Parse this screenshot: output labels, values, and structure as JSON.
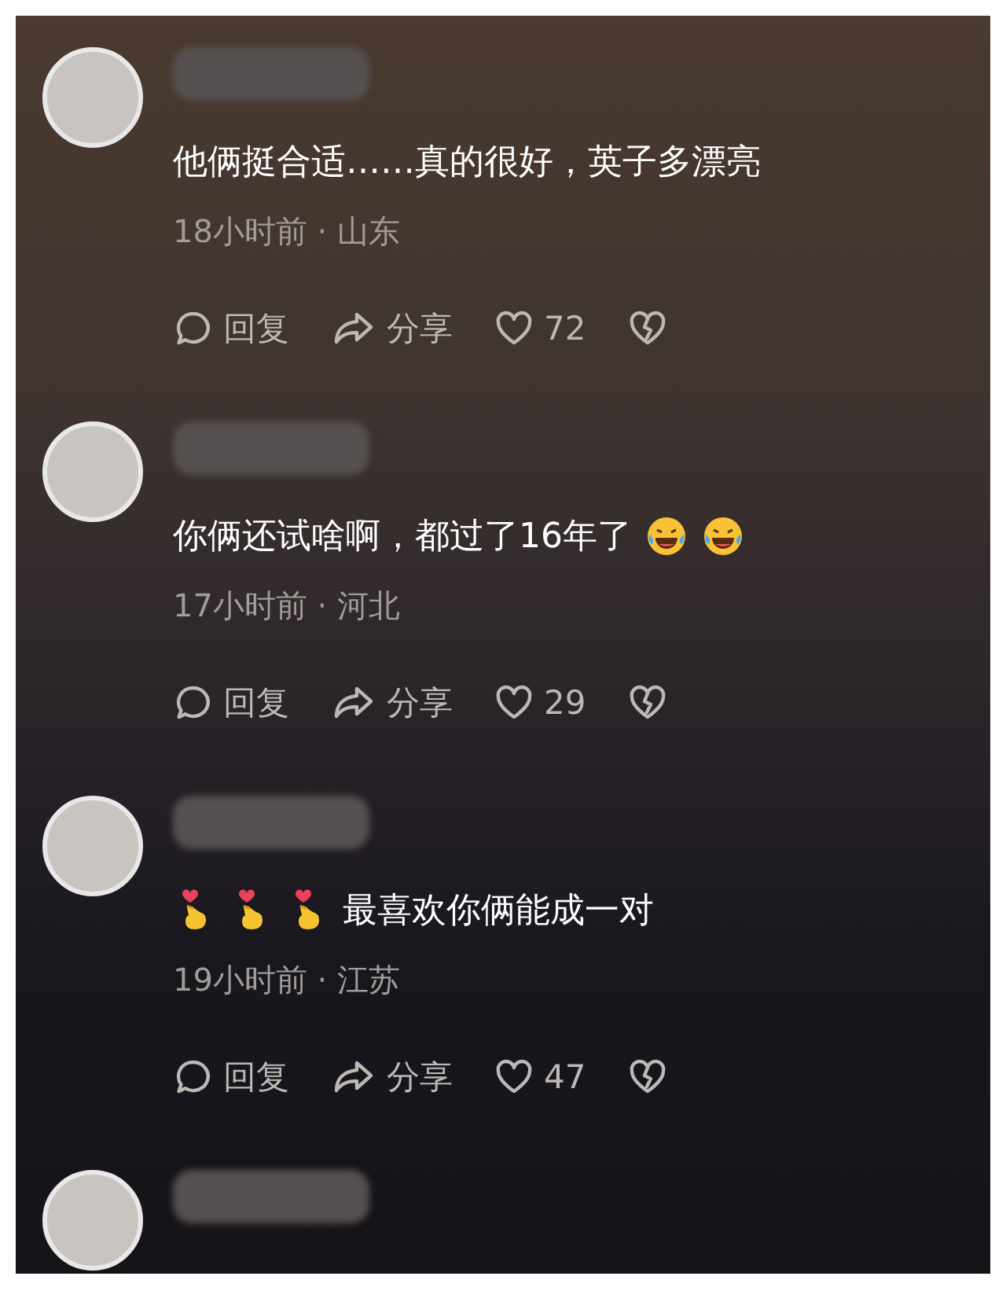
{
  "comments": [
    {
      "kind": "full",
      "content": [
        {
          "kind": "text",
          "text": "他俩挺合适……真的很好，英子多漂亮"
        }
      ],
      "meta": "18小时前 · 山东",
      "reply": "回复",
      "share": "分享",
      "likes": "72"
    },
    {
      "kind": "full",
      "content": [
        {
          "kind": "text",
          "text": "你俩还试啥啊，都过了16年了"
        },
        {
          "kind": "laugh"
        },
        {
          "kind": "laugh"
        }
      ],
      "meta": "17小时前 · 河北",
      "reply": "回复",
      "share": "分享",
      "likes": "29"
    },
    {
      "kind": "full",
      "content": [
        {
          "kind": "fingerheart"
        },
        {
          "kind": "fingerheart"
        },
        {
          "kind": "fingerheart"
        },
        {
          "kind": "text",
          "text": "最喜欢你俩能成一对"
        }
      ],
      "meta": "19小时前 · 江苏",
      "reply": "回复",
      "share": "分享",
      "likes": "47"
    },
    {
      "kind": "cut"
    }
  ]
}
